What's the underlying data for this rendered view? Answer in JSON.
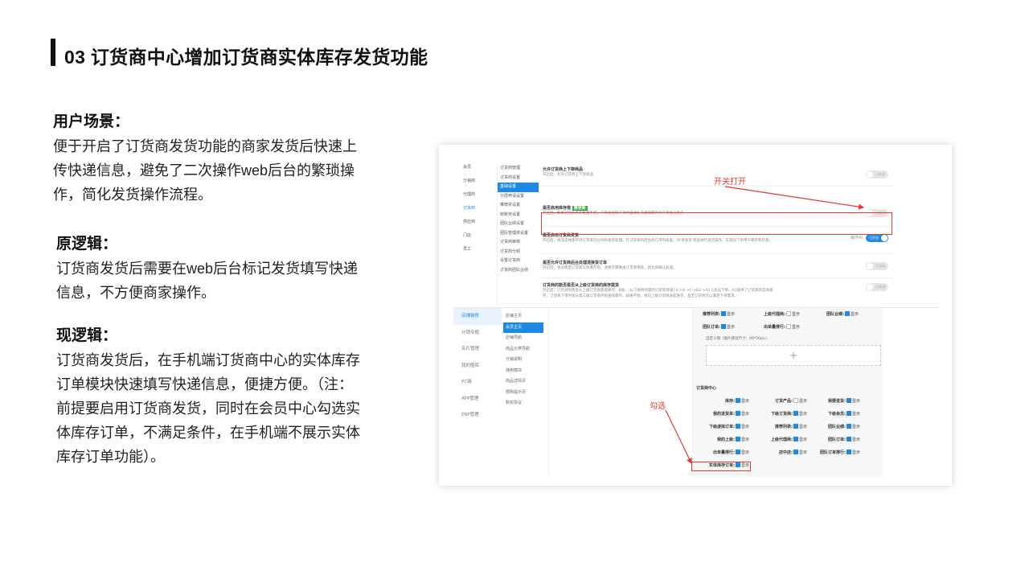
{
  "page": {
    "title": "03 订货商中心增加订货商实体库存发货功能"
  },
  "sections": [
    {
      "heading": "用户场景：",
      "lines": [
        "便于开启了订货商发货功能的商家发货后快速上",
        "传快递信息，避免了二次操作web后台的繁琐操",
        "作，简化发货操作流程。"
      ]
    },
    {
      "heading": "原逻辑：",
      "lines": [
        "订货商发货后需要在web后台标记发货填写快递",
        "信息，不方便商家操作。"
      ]
    },
    {
      "heading": "现逻辑：",
      "lines": [
        "订货商发货后，在手机端订货商中心的实体库存",
        "订单模块快速填写快递信息，便捷方便。（注：",
        "前提要启用订货商发货，同时在会员中心勾选实",
        "体库存订单，不满足条件，在手机端不展示实体",
        "库存订单功能）。"
      ]
    }
  ],
  "screenshot": {
    "annotations": {
      "switch_open": "开关打开",
      "check": "勾选"
    },
    "upper": {
      "side_items": [
        "会员",
        "分销商",
        "代理商",
        "订货商",
        "供应商",
        "门店",
        "员工"
      ],
      "side_active": 3,
      "sub_items": [
        "订货商管理",
        "订货商设置",
        "基础设置",
        "分层申请设置",
        "推荐奖设置",
        "转账奖设置",
        "团队业绩设置",
        "团队管理奖设置",
        "订货商审核",
        "订货商分组",
        "设置订货商",
        "订货商团队业绩"
      ],
      "sub_active": 2,
      "rows": [
        {
          "title": "允许订货商上下架商品",
          "desc": "开启后，允许订货商上下架商品",
          "toggle": "已关闭"
        },
        {
          "title": "是否启用库存借",
          "desc": "开启后，如果订货商库存数量不足，下单会按照下单时自动补充虚拟库存并下单会员购买",
          "toggle": "已关闭",
          "badge": "需更新"
        },
        {
          "title": "是否启用订货商发货",
          "desc": "开启后，商品实体库存对订货商可以扫码发货处理，在订货商的后台的订单列表里，对'待发货'商品进行发货操作，实现同下单用于库存和货款。",
          "toggle": "已开启",
          "extra": "操作中"
        },
        {
          "title": "是否允许订货商后台处理退换货订单",
          "desc": "开启后，会员售后订货商实体库存后，退换货需要由订货商审核，后台商确认处理。",
          "toggle": "已关闭"
        },
        {
          "title": "订货商的能否是否从上级订货商的库存提货",
          "desc": "开启后，订货商的售卖从上级订货商获取库存。B级：(以下级所代理的订货商等级) E->D->C->B2->A1 C会员下单，A1提供了订货商的实体库存。订货商下单时会从第三级订货商开始查找库存，如果不够，则向上级订货商发起进货，直至订货商可以满足下单需求。",
          "toggle": "已关闭"
        }
      ]
    },
    "lower": {
      "side_items": [
        "店铺装修",
        "分销专题",
        "名片管理",
        "我的圈库",
        "PC端",
        "APP管理",
        "ERP管理"
      ],
      "side_active": 0,
      "sub_items": [
        "店铺主页",
        "会员主页",
        "店铺导航",
        "商品分类导航",
        "分销说明",
        "通用模块",
        "商品详情页",
        "限购提示页",
        "购买协议"
      ],
      "sub_active": 1,
      "show_label": "显示",
      "top_checks": [
        {
          "label": "推荐列表:",
          "on": true
        },
        {
          "label": "上级代理商:",
          "on": false
        },
        {
          "label": "团队业绩:",
          "on": true
        },
        {
          "label": "团队订单:",
          "on": true
        },
        {
          "label": "出单量排行:",
          "on": false
        }
      ],
      "custom_label": "自定义图（图片建议尺寸：00*50px）：",
      "upload_symbol": "+",
      "center_title": "订货商中心",
      "center_checks": [
        {
          "label": "库存:",
          "on": true
        },
        {
          "label": "订货产品:",
          "on": false
        },
        {
          "label": "我要进货:",
          "on": true
        },
        {
          "label": "我的进货单:",
          "on": true
        },
        {
          "label": "下级订货商:",
          "on": true
        },
        {
          "label": "下级会员:",
          "on": true
        },
        {
          "label": "下级虚拟订单:",
          "on": true
        },
        {
          "label": "推荐列表:",
          "on": true
        },
        {
          "label": "团队业绩:",
          "on": true
        },
        {
          "label": "我的上级:",
          "on": true
        },
        {
          "label": "上级代理商:",
          "on": true
        },
        {
          "label": "团队订单:",
          "on": true
        },
        {
          "label": "出单量排行:",
          "on": true
        },
        {
          "label": "店中店:",
          "on": true
        },
        {
          "label": "团队订单排行:",
          "on": true
        },
        {
          "label": "实体库存订单:",
          "on": true
        }
      ]
    }
  },
  "colors": {
    "accent": "#1e88e5",
    "annotation_red": "#e53935",
    "title_bar": "#111111"
  }
}
